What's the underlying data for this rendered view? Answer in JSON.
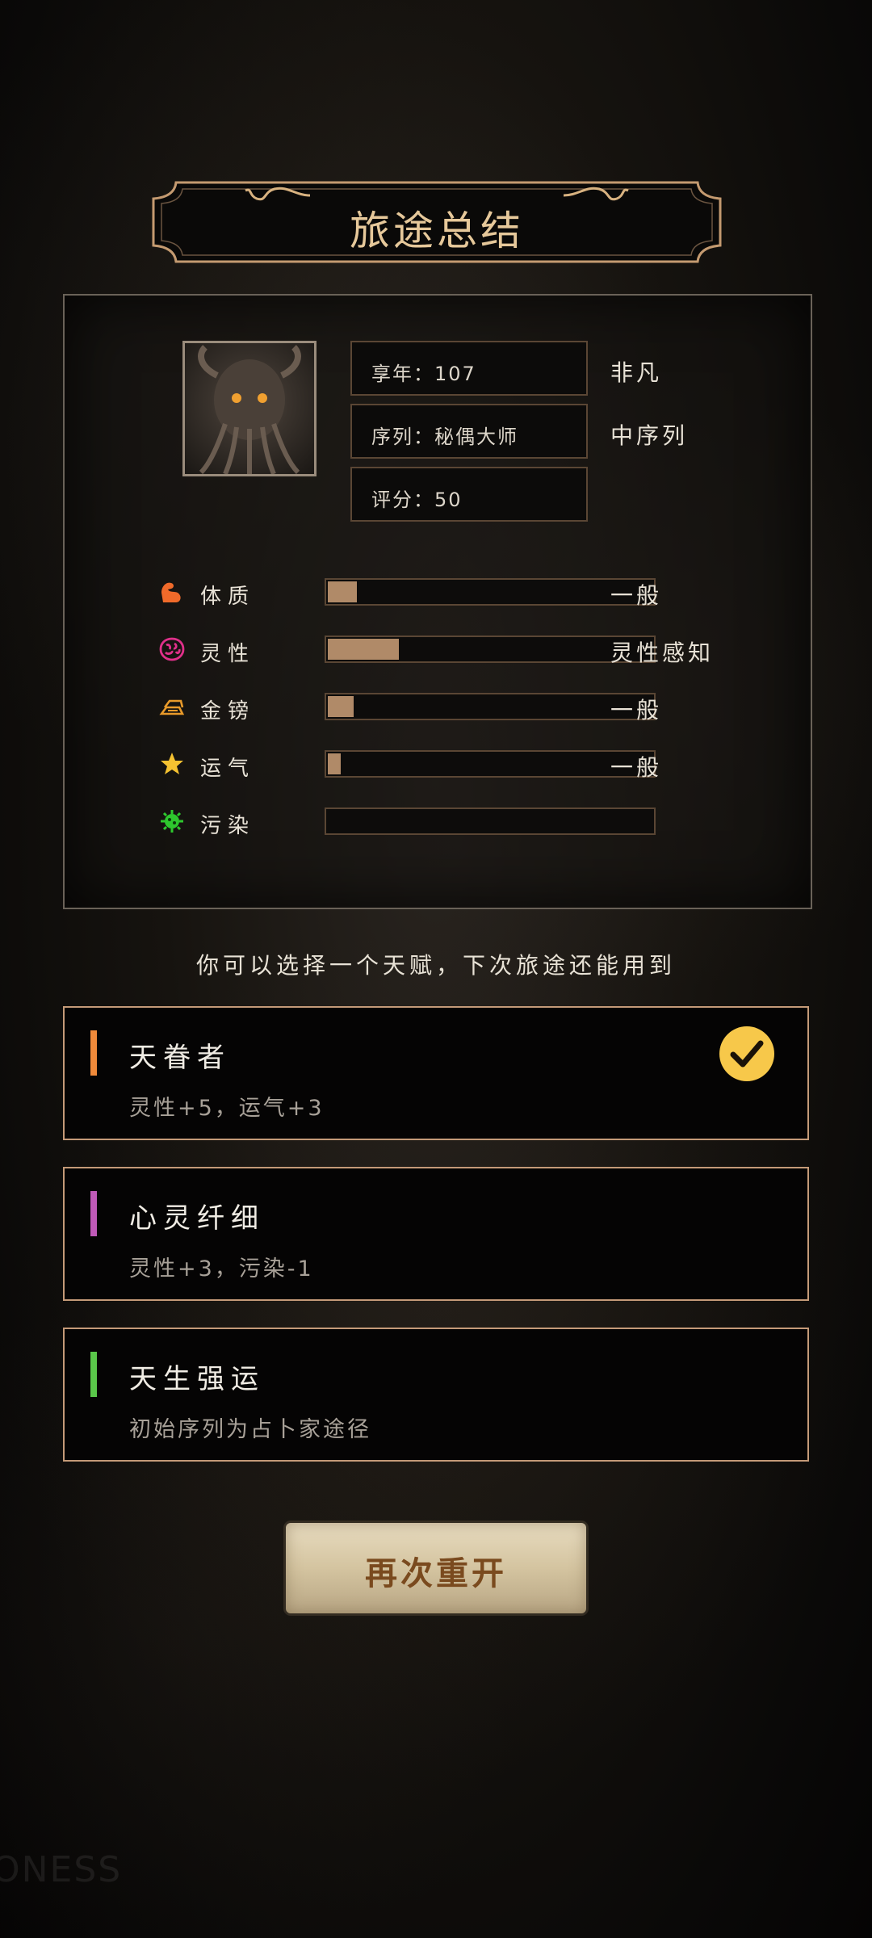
{
  "title": "旅途总结",
  "profile": {
    "age_label": "享年：107",
    "age_rating": "非凡",
    "sequence_label": "序列：秘偶大师",
    "sequence_rating": "中序列",
    "score_label": "评分：50"
  },
  "stats": [
    {
      "icon": "muscle-icon",
      "label": "体质",
      "fill": 0.09,
      "value": "一般",
      "color": "#f06a2a"
    },
    {
      "icon": "brain-icon",
      "label": "灵性",
      "fill": 0.22,
      "value": "灵性感知",
      "color": "#e0308a"
    },
    {
      "icon": "gold-bars-icon",
      "label": "金镑",
      "fill": 0.08,
      "value": "一般",
      "color": "#e89a2a"
    },
    {
      "icon": "star-icon",
      "label": "运气",
      "fill": 0.04,
      "value": "一般",
      "color": "#f5c231"
    },
    {
      "icon": "virus-icon",
      "label": "污染",
      "fill": 0.0,
      "value": "",
      "color": "#2ec82e"
    }
  ],
  "hint": "你可以选择一个天赋，下次旅途还能用到",
  "talents": [
    {
      "name": "天眷者",
      "desc": "灵性+5，运气+3",
      "stripe": "#f08a3a",
      "selected": true
    },
    {
      "name": "心灵纤细",
      "desc": "灵性+3，污染-1",
      "stripe": "#c05ab8",
      "selected": false
    },
    {
      "name": "天生强运",
      "desc": "初始序列为占卜家途径",
      "stripe": "#5ac84a",
      "selected": false
    }
  ],
  "restart_label": "再次重开",
  "watermark": "ONESS"
}
